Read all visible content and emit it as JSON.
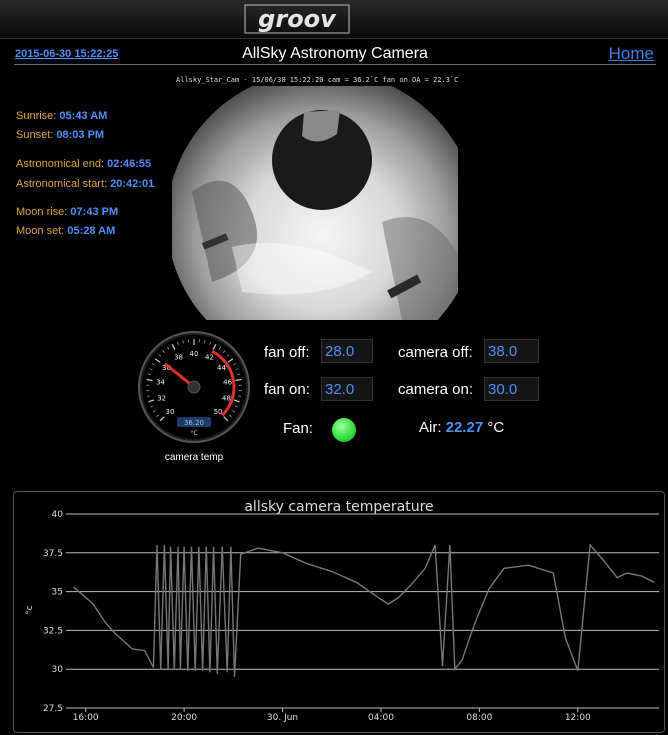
{
  "header": {
    "logo_text": "groov",
    "datetime": "2015-06-30 15:22:25",
    "title": "AllSky Astronomy Camera",
    "home_label": "Home"
  },
  "info": {
    "sunrise_label": "Sunrise:",
    "sunrise": "05:43 AM",
    "sunset_label": "Sunset:",
    "sunset": "08:03 PM",
    "astro_end_label": "Astronomical end:",
    "astro_end": "02:46:55",
    "astro_start_label": "Astronomical start:",
    "astro_start": "20:42:01",
    "moonrise_label": "Moon rise:",
    "moonrise": "07:43 PM",
    "moonset_label": "Moon set:",
    "moonset": "05:28 AM"
  },
  "camera": {
    "caption": "Allsky_Star_Cam - 15/06/30 15:22:20 cam = 36.2`C fan on OA =  22.3`C"
  },
  "gauge": {
    "label": "camera temp",
    "min": 30,
    "max": 50,
    "ticks": [
      "30",
      "32",
      "34",
      "36",
      "38",
      "40",
      "42",
      "44",
      "46",
      "48",
      "50"
    ],
    "value": 36.2,
    "value_text": "36.20",
    "unit": "°C",
    "red_from": 42
  },
  "controls": {
    "fan_off_label": "fan off:",
    "fan_off": "28.0",
    "fan_on_label": "fan on:",
    "fan_on": "32.0",
    "camera_off_label": "camera off:",
    "camera_off": "38.0",
    "camera_on_label": "camera on:",
    "camera_on": "30.0",
    "fan_label": "Fan:",
    "fan_status_color": "#2fdc3a",
    "air_label": "Air:",
    "air_value": "22.27",
    "air_unit": "°C"
  },
  "chart_data": {
    "type": "line",
    "title": "allsky camera temperature",
    "ylabel": "°c",
    "ylim": [
      27.5,
      40
    ],
    "yticks": [
      "40",
      "37.5",
      "35",
      "32.5",
      "30",
      "27.5"
    ],
    "xticks": [
      "16:00",
      "20:00",
      "30. Jun",
      "04:00",
      "08:00",
      "12:00"
    ],
    "x_hours": [
      15.5,
      16.3,
      16.8,
      17.2,
      17.9,
      18.4,
      18.75,
      18.9,
      19.05,
      19.2,
      19.35,
      19.45,
      19.6,
      19.75,
      19.85,
      20.0,
      20.15,
      20.3,
      20.45,
      20.6,
      20.75,
      20.9,
      21.05,
      21.2,
      21.35,
      21.55,
      21.75,
      21.9,
      22.05,
      22.3,
      23.0,
      24.0,
      25.0,
      26.0,
      27.0,
      28.0,
      28.3,
      28.7,
      29.2,
      29.8,
      30.2,
      30.5,
      30.8,
      31.0,
      31.3,
      31.6,
      31.9,
      32.4,
      33.0,
      34.0,
      35.0,
      35.5,
      36.0,
      36.5,
      37.0,
      37.3,
      37.6,
      38.0,
      38.6,
      39.1
    ],
    "values": [
      35.3,
      34.2,
      33.0,
      32.3,
      31.3,
      31.2,
      30.1,
      38.0,
      30.0,
      38.0,
      30.0,
      37.9,
      30.0,
      37.9,
      30.0,
      37.9,
      29.9,
      37.9,
      29.9,
      37.9,
      29.9,
      37.9,
      29.8,
      37.9,
      29.7,
      37.9,
      29.8,
      37.9,
      29.5,
      37.4,
      37.8,
      37.5,
      36.8,
      36.3,
      35.6,
      34.5,
      34.2,
      34.6,
      35.4,
      36.5,
      38.0,
      30.2,
      38.0,
      30.0,
      30.6,
      32.0,
      33.3,
      35.2,
      36.5,
      36.7,
      36.2,
      32.0,
      29.9,
      38.0,
      37.1,
      36.5,
      35.9,
      36.2,
      36.0,
      35.6
    ]
  }
}
